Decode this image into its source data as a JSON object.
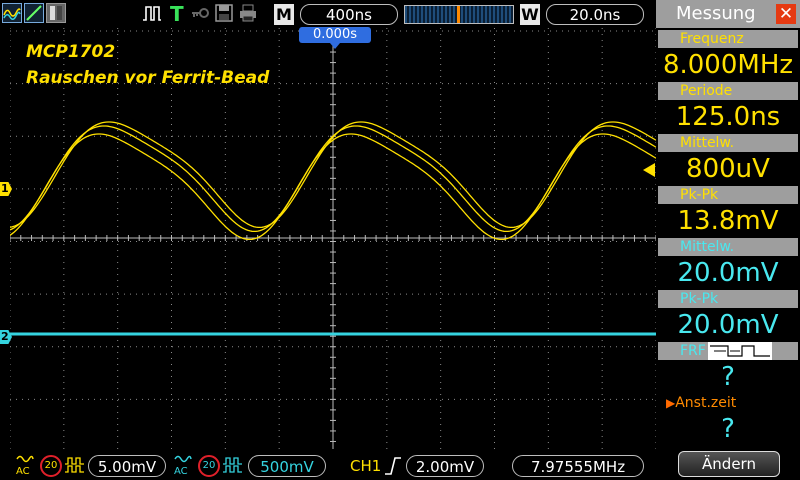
{
  "topbar": {
    "timebase_label": "M",
    "timebase": "400ns",
    "window_label": "W",
    "window": "20.0ns",
    "trigger_mode": "T",
    "trigger_offset": "0.000s"
  },
  "annotation": {
    "line1": "MCP1702",
    "line2": "Rauschen vor Ferrit-Bead"
  },
  "channel_markers": {
    "ch1": "1",
    "ch2": "2"
  },
  "bottombar": {
    "ch1_bw": "20",
    "ch1_scale": "5.00mV",
    "ch2_bw": "20",
    "ch2_scale": "500mV",
    "trigger_source": "CH1",
    "trigger_level": "2.00mV",
    "frequency": "7.97555MHz"
  },
  "sidebar": {
    "title": "Messung",
    "items": [
      {
        "label": "Frequenz",
        "value": "8.000MHz",
        "color": "yellow"
      },
      {
        "label": "Periode",
        "value": "125.0ns",
        "color": "yellow"
      },
      {
        "label": "Mittelw.",
        "value": "800uV",
        "color": "yellow"
      },
      {
        "label": "Pk-Pk",
        "value": "13.8mV",
        "color": "yellow"
      },
      {
        "label": "Mittelw.",
        "value": "20.0mV",
        "color": "cyan"
      },
      {
        "label": "Pk-Pk",
        "value": "20.0mV",
        "color": "cyan"
      },
      {
        "label": "FRF",
        "value": "?",
        "color": "cyan"
      },
      {
        "label": "Anst.zeit",
        "value": "?",
        "color": "cyan"
      }
    ],
    "button": "Ändern"
  },
  "colors": {
    "ch1": "#ffe000",
    "ch2": "#35d4e0",
    "grid": "#8a8a8a"
  }
}
